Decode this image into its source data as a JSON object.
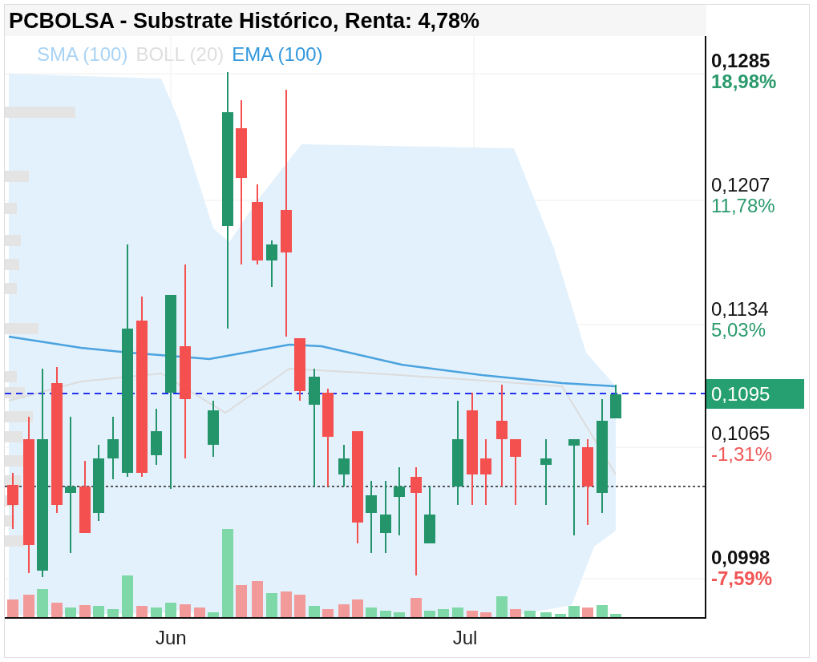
{
  "title": "PCBOLSA - Substrate Histórico, Renta: 4,78%",
  "legend": [
    {
      "label": "SMA (100)",
      "color": "#a9d3f5"
    },
    {
      "label": "BOLL (20)",
      "color": "#dedede"
    },
    {
      "label": "EMA (100)",
      "color": "#3399dd"
    }
  ],
  "price_levels": [
    {
      "price": "0,1285",
      "change": "18,98%",
      "kind": "up",
      "bold": true
    },
    {
      "price": "0,1207",
      "change": "11,78%",
      "kind": "up",
      "bold": false
    },
    {
      "price": "0,1134",
      "change": "5,03%",
      "kind": "up",
      "bold": false
    },
    {
      "price": "0,1065",
      "change": "-1,31%",
      "kind": "down",
      "bold": false
    },
    {
      "price": "0,0998",
      "change": "-7,59%",
      "kind": "down",
      "bold": true
    }
  ],
  "current_price": {
    "label": "0,1095"
  },
  "x_labels": [
    "Jun",
    "Jul"
  ]
}
